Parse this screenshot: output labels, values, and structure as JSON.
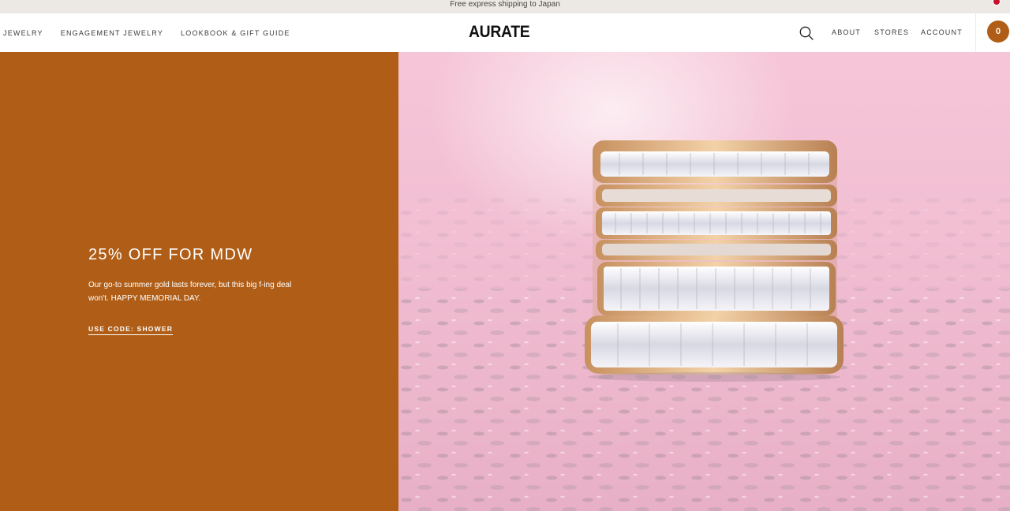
{
  "announcement": {
    "text": "Free express shipping to Japan"
  },
  "nav": {
    "left": [
      "JEWELRY",
      "ENGAGEMENT JEWELRY",
      "LOOKBOOK & GIFT GUIDE"
    ],
    "logo": "AURATE",
    "right": [
      "ABOUT",
      "STORES",
      "ACCOUNT"
    ],
    "cart_count": "0",
    "icons": {
      "search": "search-icon",
      "flag": "japan-flag-icon"
    }
  },
  "hero": {
    "title": "25% OFF FOR MDW",
    "description": "Our go-to summer gold lasts forever, but this big f-ing deal won't. HAPPY MEMORIAL DAY.",
    "code_label": "USE CODE: SHOWER",
    "image_alt": "stacked-diamond-eternity-rings"
  },
  "colors": {
    "accent": "#b05e17",
    "announcement_bg": "#ece9e4",
    "image_bg": "#f0bccf"
  }
}
